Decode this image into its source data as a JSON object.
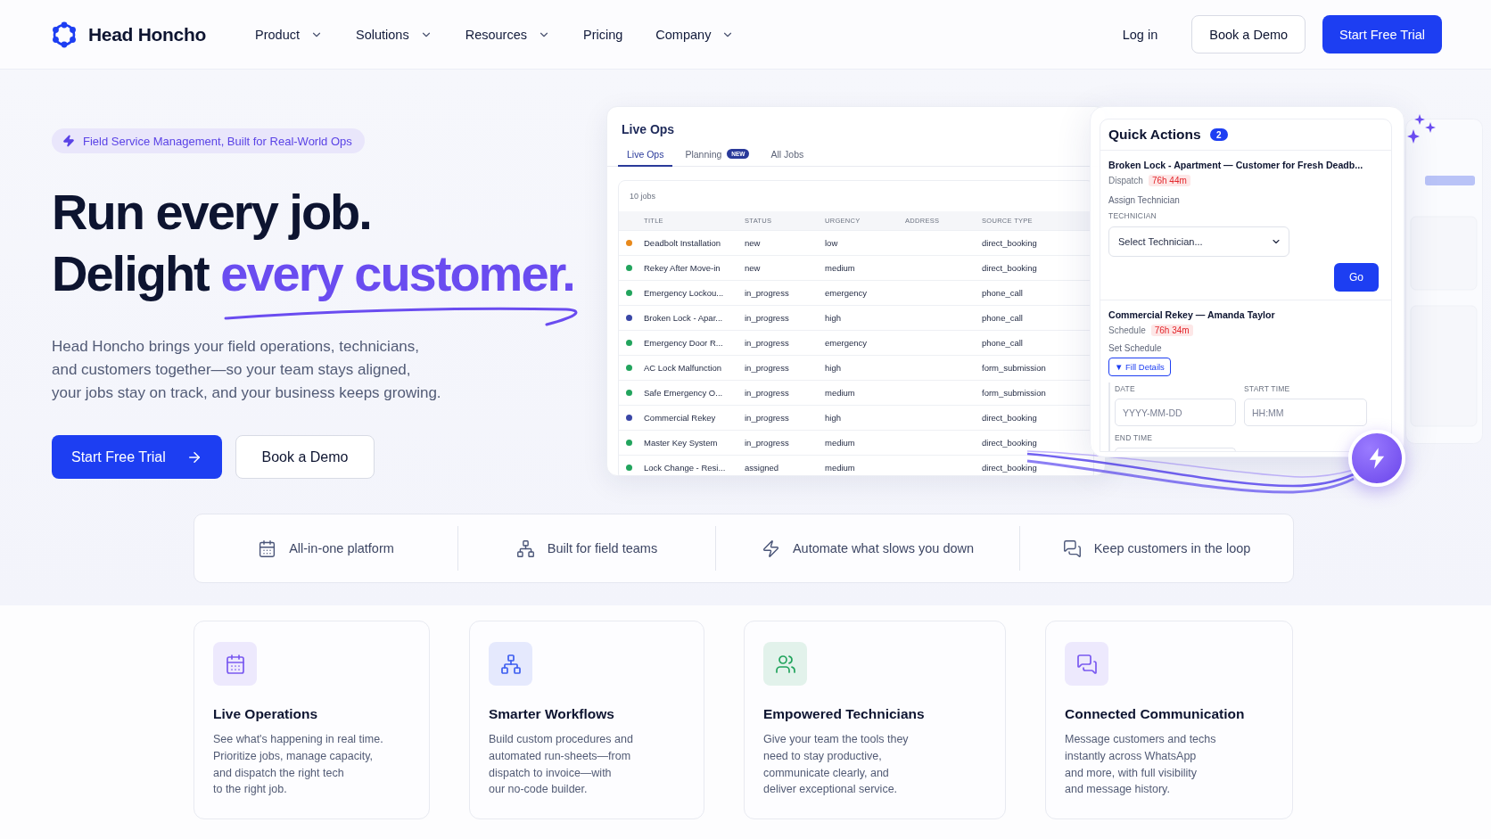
{
  "header": {
    "brand": "Head Honcho",
    "nav": [
      {
        "label": "Product",
        "dropdown": true
      },
      {
        "label": "Solutions",
        "dropdown": true
      },
      {
        "label": "Resources",
        "dropdown": true
      },
      {
        "label": "Pricing",
        "dropdown": false
      },
      {
        "label": "Company",
        "dropdown": true
      }
    ],
    "login": "Log in",
    "buttons": [
      {
        "label": "Book a Demo",
        "kind": "secondary"
      },
      {
        "label": "Start Free Trial",
        "kind": "primary"
      }
    ]
  },
  "hero": {
    "badge": "Field Service Management, Built for Real-World Ops",
    "headline": "Run every job.",
    "headline_second": "Delight",
    "headline_accent": "every customer.",
    "description": "Head Honcho brings your field operations, technicians,\nand customers together—so your team stays aligned,\nyour jobs stay on track, and your business keeps growing.",
    "buttons": [
      {
        "label": "Start Free Trial",
        "kind": "primary"
      },
      {
        "label": "Book a Demo",
        "kind": "secondary"
      }
    ]
  },
  "live_ops": {
    "title": "Live Ops",
    "tabs": [
      {
        "label": "Live Ops",
        "selected": true
      },
      {
        "label": "Planning",
        "selected": false,
        "badge": "NEW"
      },
      {
        "label": "All Jobs",
        "selected": false
      }
    ],
    "count": "10 jobs",
    "columns": [
      "TITLE",
      "STATUS",
      "URGENCY",
      "ADDRESS",
      "SOURCE TYPE"
    ],
    "rows": [
      {
        "color": "#e8891c",
        "title": "Deadbolt Installation",
        "status": "new",
        "urgency": "low",
        "source_type": "direct_booking"
      },
      {
        "color": "#22a45d",
        "title": "Rekey After Move-in",
        "status": "new",
        "urgency": "medium",
        "source_type": "direct_booking"
      },
      {
        "color": "#22a45d",
        "title": "Emergency Lockou...",
        "status": "in_progress",
        "urgency": "emergency",
        "source_type": "phone_call"
      },
      {
        "color": "#3946a6",
        "title": "Broken Lock - Apar...",
        "status": "in_progress",
        "urgency": "high",
        "source_type": "phone_call"
      },
      {
        "color": "#22a45d",
        "title": "Emergency Door R...",
        "status": "in_progress",
        "urgency": "emergency",
        "source_type": "phone_call"
      },
      {
        "color": "#22a45d",
        "title": "AC Lock Malfunction",
        "status": "in_progress",
        "urgency": "high",
        "source_type": "form_submission"
      },
      {
        "color": "#22a45d",
        "title": "Safe Emergency O...",
        "status": "in_progress",
        "urgency": "medium",
        "source_type": "form_submission"
      },
      {
        "color": "#3946a6",
        "title": "Commercial Rekey",
        "status": "in_progress",
        "urgency": "high",
        "source_type": "direct_booking"
      },
      {
        "color": "#22a45d",
        "title": "Master Key System",
        "status": "in_progress",
        "urgency": "medium",
        "source_type": "direct_booking"
      },
      {
        "color": "#22a45d",
        "title": "Lock Change - Resi...",
        "status": "assigned",
        "urgency": "medium",
        "source_type": "direct_booking"
      }
    ]
  },
  "quick_actions": {
    "title": "Quick Actions",
    "count": "2",
    "items": [
      {
        "kind": "dispatch",
        "title": "Broken Lock - Apartment — Customer for Fresh Deadb...",
        "type": "Dispatch",
        "timer": "76h 44m",
        "action": "Assign Technician",
        "field_label": "TECHNICIAN",
        "select_placeholder": "Select Technician...",
        "button": "Go"
      },
      {
        "kind": "schedule",
        "title": "Commercial Rekey — Amanda Taylor",
        "type": "Schedule",
        "timer": "76h 34m",
        "action": "Set Schedule",
        "toggle": "▼ Fill Details",
        "fields": [
          {
            "label": "DATE",
            "placeholder": "YYYY-MM-DD"
          },
          {
            "label": "START TIME",
            "placeholder": "HH:MM"
          },
          {
            "label": "END TIME"
          }
        ]
      }
    ]
  },
  "features": [
    {
      "label": "All-in-one platform"
    },
    {
      "label": "Built for field teams"
    },
    {
      "label": "Automate what slows you down"
    },
    {
      "label": "Keep customers in the loop"
    }
  ],
  "cards": [
    {
      "title": "Live Operations",
      "color": "#7a5af0",
      "description": "See what's happening in real time.\nPrioritize jobs, manage capacity,\nand dispatch the right tech\nto the right job."
    },
    {
      "title": "Smarter Workflows",
      "color": "#3d5ef0",
      "description": "Build custom procedures and\nautomated run-sheets—from\ndispatch to invoice—with\nour no-code builder."
    },
    {
      "title": "Empowered Technicians",
      "color": "#22a45d",
      "description": "Give your team the tools they\nneed to stay productive,\ncommunicate clearly, and\ndeliver exceptional service."
    },
    {
      "title": "Connected Communication",
      "color": "#7a5af0",
      "description": "Message customers and techs\ninstantly across WhatsApp\nand more, with full visibility\nand message history."
    }
  ]
}
